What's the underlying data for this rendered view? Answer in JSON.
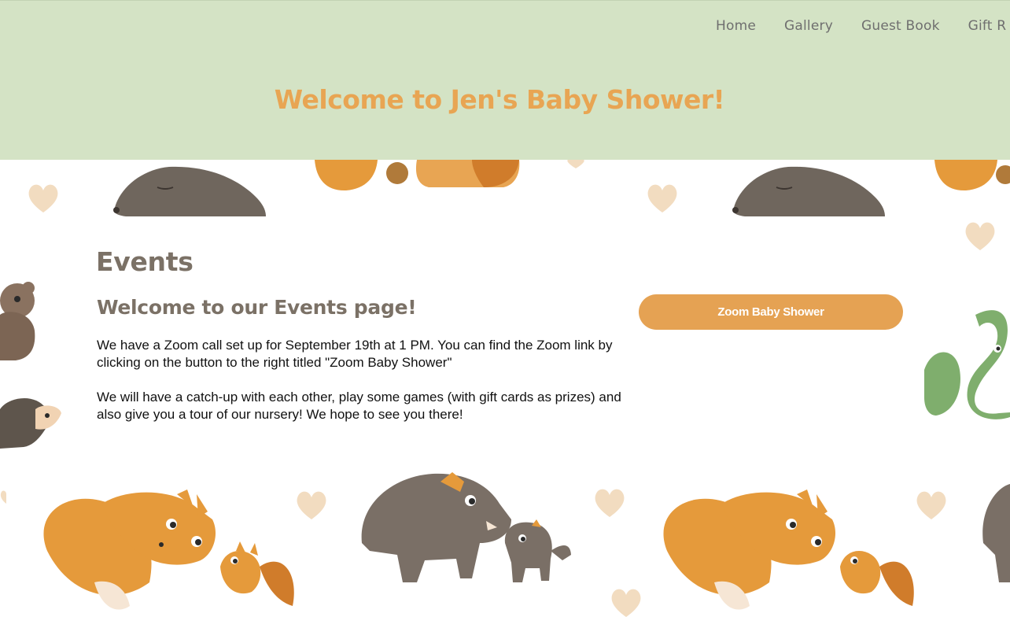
{
  "header": {
    "nav": [
      "Home",
      "Gallery",
      "Guest Book",
      "Gift R"
    ],
    "title": "Welcome to Jen's Baby Shower!"
  },
  "main": {
    "heading": "Events",
    "subheading": "Welcome to our Events page!",
    "paragraphs": [
      "We have a Zoom call set up for September 19th at 1 PM. You can find the Zoom link by clicking on the button to the right titled \"Zoom Baby Shower\"",
      "We will have a catch-up with each other, play some games (with gift cards as prizes) and also give you a tour of our nursery! We hope to see you there!"
    ],
    "zoom_button": "Zoom Baby Shower"
  },
  "colors": {
    "header_bg": "#d4e3c5",
    "title": "#e8a553",
    "heading": "#7b7166",
    "button": "#e5a253",
    "fox": "#e59a3b",
    "boar": "#7a6f66",
    "heart": "#f2dcc0",
    "snake": "#7fae6d"
  },
  "background": {
    "pattern": "woodland-animals-with-hearts",
    "animals": [
      "mole",
      "squirrel",
      "bear",
      "hedgehog",
      "snake",
      "fox",
      "fox-kit",
      "boar",
      "boar-piglet"
    ]
  }
}
